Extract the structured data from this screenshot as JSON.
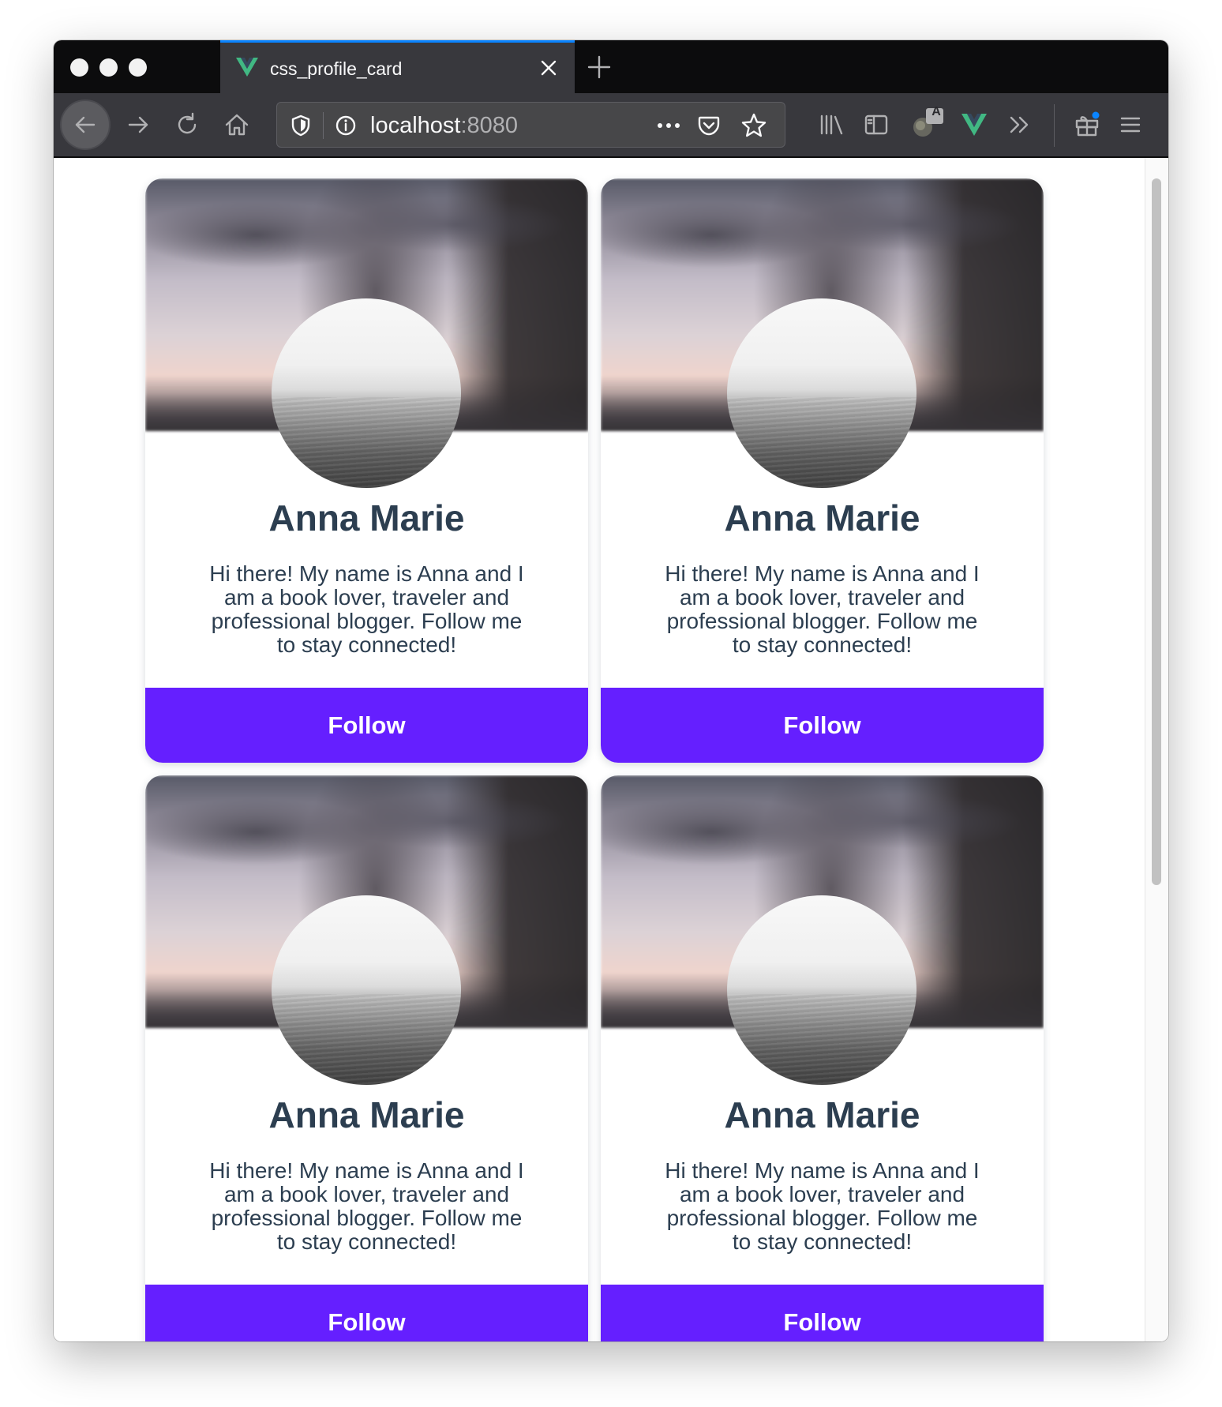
{
  "browser": {
    "tab_title": "css_profile_card",
    "url_host": "localhost",
    "url_port": ":8080",
    "extension_badge": "A",
    "accent_color": "#0a84ff"
  },
  "cards": [
    {
      "name": "Anna Marie",
      "bio": "Hi there! My name is Anna and I am a book lover, traveler and professional blogger. Follow me to stay connected!",
      "button_label": "Follow"
    },
    {
      "name": "Anna Marie",
      "bio": "Hi there! My name is Anna and I am a book lover, traveler and professional blogger. Follow me to stay connected!",
      "button_label": "Follow"
    },
    {
      "name": "Anna Marie",
      "bio": "Hi there! My name is Anna and I am a book lover, traveler and professional blogger. Follow me to stay connected!",
      "button_label": "Follow"
    },
    {
      "name": "Anna Marie",
      "bio": "Hi there! My name is Anna and I am a book lover, traveler and professional blogger. Follow me to stay connected!",
      "button_label": "Follow"
    }
  ],
  "theme": {
    "button_color": "#651fff",
    "text_color": "#2c3e50",
    "vue_green": "#41b883"
  },
  "icons": [
    "vue-logo-icon",
    "close-icon",
    "plus-icon",
    "back-arrow-icon",
    "forward-arrow-icon",
    "reload-icon",
    "home-icon",
    "shield-icon",
    "info-icon",
    "more-dots-icon",
    "pocket-icon",
    "star-icon",
    "library-icon",
    "sidebar-icon",
    "translate-icon",
    "vue-devtools-icon",
    "overflow-chevron-icon",
    "gift-icon",
    "hamburger-menu-icon"
  ]
}
